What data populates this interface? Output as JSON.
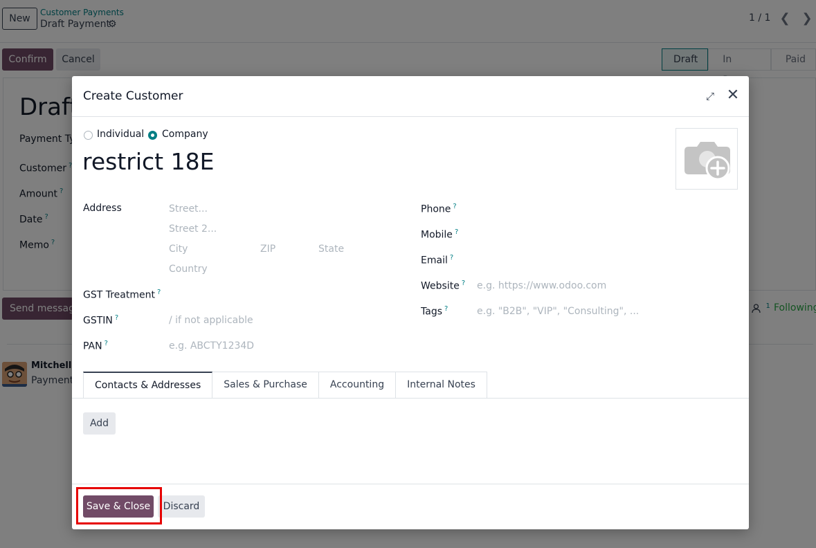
{
  "background": {
    "new_label": "New",
    "breadcrumb_parent": "Customer Payments",
    "breadcrumb_current": "Draft Payment",
    "gear_icon": "⚙",
    "pager": "1 / 1",
    "prev_icon": "❮",
    "next_icon": "❯",
    "confirm_label": "Confirm",
    "cancel_label": "Cancel",
    "statuses": [
      "Draft",
      "In Process",
      "Paid"
    ],
    "draft_title": "Draft",
    "fields": [
      "Payment Type",
      "Customer",
      "Amount",
      "Date",
      "Memo"
    ],
    "send_message_label": "Send message",
    "followers_count": "1",
    "following_label": "Following",
    "message_author": "Mitchell Admin",
    "message_text": "Payments"
  },
  "modal": {
    "title": "Create Customer",
    "expand_icon": "⤢",
    "close_icon": "✕",
    "radio_individual": "Individual",
    "radio_company": "Company",
    "company_type": "company",
    "name": "restrict 18E",
    "left_fields": {
      "address_label": "Address",
      "street_placeholder": "Street...",
      "street2_placeholder": "Street 2...",
      "city_placeholder": "City",
      "zip_placeholder": "ZIP",
      "state_placeholder": "State",
      "country_placeholder": "Country",
      "gst_label": "GST Treatment",
      "gstin_label": "GSTIN",
      "gstin_placeholder": "/ if not applicable",
      "pan_label": "PAN",
      "pan_placeholder": "e.g. ABCTY1234D"
    },
    "right_fields": {
      "phone_label": "Phone",
      "mobile_label": "Mobile",
      "email_label": "Email",
      "website_label": "Website",
      "website_placeholder": "e.g. https://www.odoo.com",
      "tags_label": "Tags",
      "tags_placeholder": "e.g. \"B2B\", \"VIP\", \"Consulting\", ..."
    },
    "help_marker": "?",
    "tabs": [
      "Contacts & Addresses",
      "Sales & Purchase",
      "Accounting",
      "Internal Notes"
    ],
    "active_tab": "Contacts & Addresses",
    "add_label": "Add",
    "save_label": "Save & Close",
    "discard_label": "Discard"
  },
  "colors": {
    "primary": "#714b67",
    "accent": "#017e84",
    "highlight": "#e60000"
  }
}
